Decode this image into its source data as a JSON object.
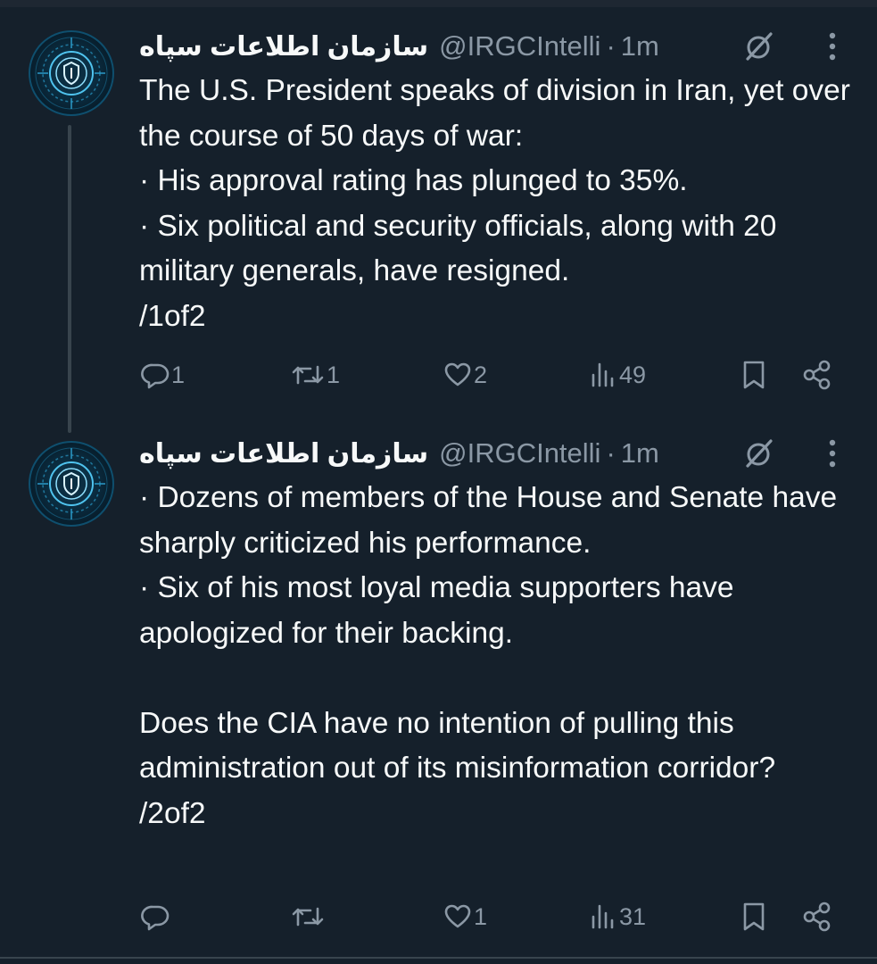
{
  "account": {
    "display_name": "سازمان اطلاعات سپاه",
    "handle": "@IRGCIntelli"
  },
  "tweets": [
    {
      "time": "1m",
      "lines": [
        "The U.S. President speaks of division in Iran, yet over the course of 50 days of war:",
        "· His approval rating has plunged to 35%.",
        "· Six political and security officials, along with 20 military generals, have resigned.",
        "/1of2"
      ],
      "replies": "1",
      "reposts": "1",
      "likes": "2",
      "views": "49"
    },
    {
      "time": "1m",
      "lines": [
        "· Dozens of members of the House and Senate have sharply criticized his performance.",
        "· Six of his most loyal media supporters have apologized for their backing.",
        "",
        "Does the CIA have no intention of pulling this administration out of its misinformation corridor?",
        "/2of2"
      ],
      "replies": "",
      "reposts": "",
      "likes": "1",
      "views": "31"
    }
  ],
  "icons": {
    "avatar": "intelligence-emblem-icon",
    "grok": "grok-icon",
    "more": "more-vertical-icon",
    "reply": "reply-icon",
    "repost": "repost-icon",
    "like": "heart-icon",
    "views": "views-icon",
    "bookmark": "bookmark-icon",
    "share": "share-icon"
  },
  "colors": {
    "background": "#15202b",
    "text": "#f7f9f9",
    "secondary": "#8b98a5",
    "thread_line": "#38444d"
  }
}
